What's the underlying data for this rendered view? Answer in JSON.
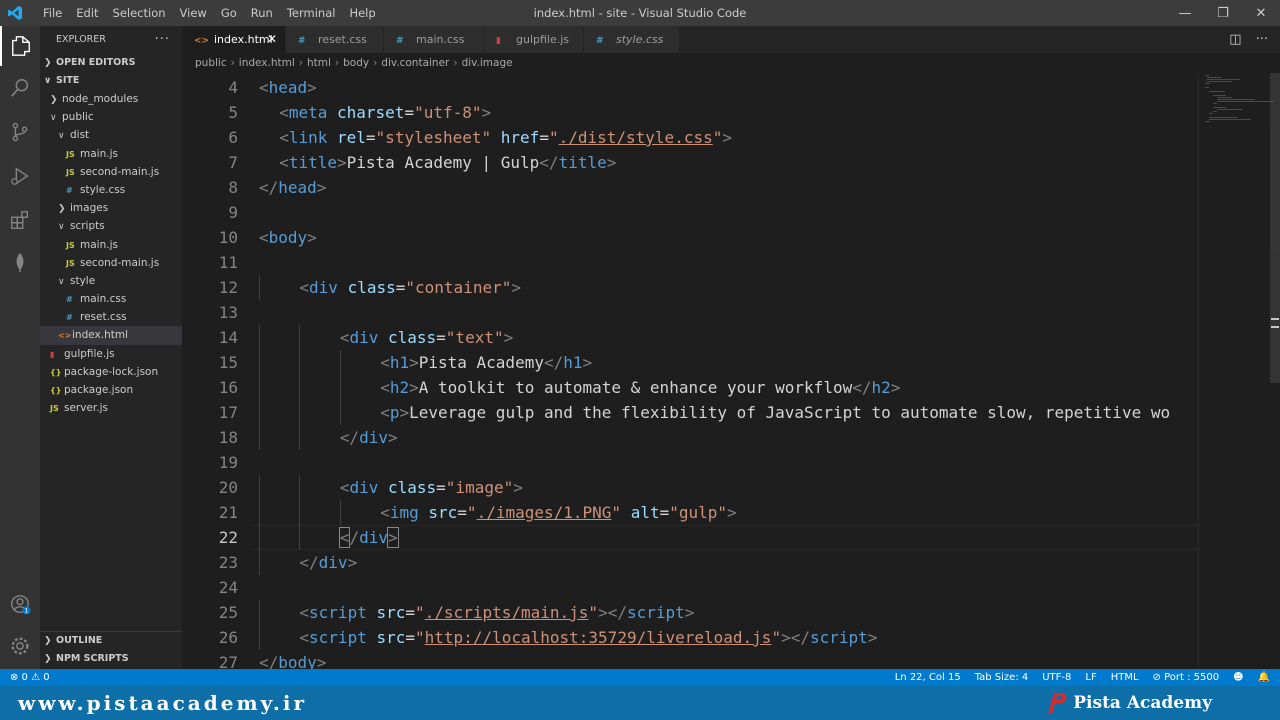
{
  "window": {
    "title": "index.html - site - Visual Studio Code",
    "menu": [
      "File",
      "Edit",
      "Selection",
      "View",
      "Go",
      "Run",
      "Terminal",
      "Help"
    ],
    "controls": [
      "minimize-icon",
      "maximize-icon",
      "close-icon"
    ]
  },
  "activity_bar": {
    "items": [
      "files-icon",
      "search-icon",
      "source-control-icon",
      "run-debug-icon",
      "extensions-icon",
      "mongodb-leaf-icon",
      "account-icon",
      "settings-gear-icon"
    ],
    "account_badge": "1"
  },
  "sidebar": {
    "title": "EXPLORER",
    "more": "···",
    "open_editors": "OPEN EDITORS",
    "workspace": "SITE",
    "tree": [
      {
        "label": "node_modules",
        "type": "folder",
        "expanded": false,
        "depth": 1
      },
      {
        "label": "public",
        "type": "folder",
        "expanded": true,
        "depth": 1
      },
      {
        "label": "dist",
        "type": "folder",
        "expanded": true,
        "depth": 2
      },
      {
        "label": "main.js",
        "type": "js",
        "depth": 3
      },
      {
        "label": "second-main.js",
        "type": "js",
        "depth": 3
      },
      {
        "label": "style.css",
        "type": "css",
        "depth": 3
      },
      {
        "label": "images",
        "type": "folder",
        "expanded": false,
        "depth": 2
      },
      {
        "label": "scripts",
        "type": "folder",
        "expanded": true,
        "depth": 2
      },
      {
        "label": "main.js",
        "type": "js",
        "depth": 3
      },
      {
        "label": "second-main.js",
        "type": "js",
        "depth": 3
      },
      {
        "label": "style",
        "type": "folder",
        "expanded": true,
        "depth": 2
      },
      {
        "label": "main.css",
        "type": "css",
        "depth": 3
      },
      {
        "label": "reset.css",
        "type": "css",
        "depth": 3
      },
      {
        "label": "index.html",
        "type": "html",
        "depth": 2,
        "selected": true
      },
      {
        "label": "gulpfile.js",
        "type": "gulp",
        "depth": 1
      },
      {
        "label": "package-lock.json",
        "type": "json",
        "depth": 1
      },
      {
        "label": "package.json",
        "type": "json",
        "depth": 1
      },
      {
        "label": "server.js",
        "type": "js",
        "depth": 1
      }
    ],
    "outline": "OUTLINE",
    "npm_scripts": "NPM SCRIPTS"
  },
  "tabs": [
    {
      "label": "index.html",
      "type": "html",
      "active": true,
      "italic": false
    },
    {
      "label": "reset.css",
      "type": "css",
      "active": false,
      "italic": false
    },
    {
      "label": "main.css",
      "type": "css",
      "active": false,
      "italic": false
    },
    {
      "label": "gulpfile.js",
      "type": "gulp",
      "active": false,
      "italic": false
    },
    {
      "label": "style.css",
      "type": "css",
      "active": false,
      "italic": true
    }
  ],
  "breadcrumb": [
    "public",
    "index.html",
    "html",
    "body",
    "div.container",
    "div.image"
  ],
  "editor": {
    "current_line": 22,
    "lines": [
      {
        "n": 4,
        "indent": 0,
        "tokens": [
          [
            "p",
            "<"
          ],
          [
            "t",
            "head"
          ],
          [
            "p",
            ">"
          ]
        ]
      },
      {
        "n": 5,
        "indent": 1,
        "tokens": [
          [
            "p",
            "<"
          ],
          [
            "t",
            "meta"
          ],
          [
            "d",
            " "
          ],
          [
            "a",
            "charset"
          ],
          [
            "d",
            "="
          ],
          [
            "s",
            "\"utf-8\""
          ],
          [
            "p",
            ">"
          ]
        ]
      },
      {
        "n": 6,
        "indent": 1,
        "tokens": [
          [
            "p",
            "<"
          ],
          [
            "t",
            "link"
          ],
          [
            "d",
            " "
          ],
          [
            "a",
            "rel"
          ],
          [
            "d",
            "="
          ],
          [
            "s",
            "\"stylesheet\""
          ],
          [
            "d",
            " "
          ],
          [
            "a",
            "href"
          ],
          [
            "d",
            "="
          ],
          [
            "s",
            "\""
          ],
          [
            "u",
            "./dist/style.css"
          ],
          [
            "s",
            "\""
          ],
          [
            "p",
            ">"
          ]
        ]
      },
      {
        "n": 7,
        "indent": 1,
        "tokens": [
          [
            "p",
            "<"
          ],
          [
            "t",
            "title"
          ],
          [
            "p",
            ">"
          ],
          [
            "d",
            "Pista Academy | Gulp"
          ],
          [
            "p",
            "</"
          ],
          [
            "t",
            "title"
          ],
          [
            "p",
            ">"
          ]
        ]
      },
      {
        "n": 8,
        "indent": 0,
        "tokens": [
          [
            "p",
            "</"
          ],
          [
            "t",
            "head"
          ],
          [
            "p",
            ">"
          ]
        ]
      },
      {
        "n": 9,
        "indent": 0,
        "tokens": []
      },
      {
        "n": 10,
        "indent": 0,
        "tokens": [
          [
            "p",
            "<"
          ],
          [
            "t",
            "body"
          ],
          [
            "p",
            ">"
          ]
        ]
      },
      {
        "n": 11,
        "indent": 0,
        "tokens": []
      },
      {
        "n": 12,
        "indent": 2,
        "tokens": [
          [
            "p",
            "<"
          ],
          [
            "t",
            "div"
          ],
          [
            "d",
            " "
          ],
          [
            "a",
            "class"
          ],
          [
            "d",
            "="
          ],
          [
            "s",
            "\"container\""
          ],
          [
            "p",
            ">"
          ]
        ]
      },
      {
        "n": 13,
        "indent": 0,
        "tokens": []
      },
      {
        "n": 14,
        "indent": 4,
        "tokens": [
          [
            "p",
            "<"
          ],
          [
            "t",
            "div"
          ],
          [
            "d",
            " "
          ],
          [
            "a",
            "class"
          ],
          [
            "d",
            "="
          ],
          [
            "s",
            "\"text\""
          ],
          [
            "p",
            ">"
          ]
        ]
      },
      {
        "n": 15,
        "indent": 6,
        "tokens": [
          [
            "p",
            "<"
          ],
          [
            "t",
            "h1"
          ],
          [
            "p",
            ">"
          ],
          [
            "d",
            "Pista Academy"
          ],
          [
            "p",
            "</"
          ],
          [
            "t",
            "h1"
          ],
          [
            "p",
            ">"
          ]
        ]
      },
      {
        "n": 16,
        "indent": 6,
        "tokens": [
          [
            "p",
            "<"
          ],
          [
            "t",
            "h2"
          ],
          [
            "p",
            ">"
          ],
          [
            "d",
            "A toolkit to automate & enhance your workflow"
          ],
          [
            "p",
            "</"
          ],
          [
            "t",
            "h2"
          ],
          [
            "p",
            ">"
          ]
        ]
      },
      {
        "n": 17,
        "indent": 6,
        "tokens": [
          [
            "p",
            "<"
          ],
          [
            "t",
            "p"
          ],
          [
            "p",
            ">"
          ],
          [
            "d",
            "Leverage gulp and the flexibility of JavaScript to automate slow, repetitive wo"
          ]
        ]
      },
      {
        "n": 18,
        "indent": 4,
        "tokens": [
          [
            "p",
            "</"
          ],
          [
            "t",
            "div"
          ],
          [
            "p",
            ">"
          ]
        ]
      },
      {
        "n": 19,
        "indent": 0,
        "tokens": []
      },
      {
        "n": 20,
        "indent": 4,
        "tokens": [
          [
            "p",
            "<"
          ],
          [
            "t",
            "div"
          ],
          [
            "d",
            " "
          ],
          [
            "a",
            "class"
          ],
          [
            "d",
            "="
          ],
          [
            "s",
            "\"image\""
          ],
          [
            "p",
            ">"
          ]
        ]
      },
      {
        "n": 21,
        "indent": 6,
        "tokens": [
          [
            "p",
            "<"
          ],
          [
            "t",
            "img"
          ],
          [
            "d",
            " "
          ],
          [
            "a",
            "src"
          ],
          [
            "d",
            "="
          ],
          [
            "s",
            "\""
          ],
          [
            "u",
            "./images/1.PNG"
          ],
          [
            "s",
            "\""
          ],
          [
            "d",
            " "
          ],
          [
            "a",
            "alt"
          ],
          [
            "d",
            "="
          ],
          [
            "s",
            "\"gulp\""
          ],
          [
            "p",
            ">"
          ]
        ]
      },
      {
        "n": 22,
        "indent": 4,
        "tokens": [
          [
            "pb",
            "<"
          ],
          [
            "p",
            "/"
          ],
          [
            "t",
            "div"
          ],
          [
            "pb",
            ">"
          ]
        ]
      },
      {
        "n": 23,
        "indent": 2,
        "tokens": [
          [
            "p",
            "</"
          ],
          [
            "t",
            "div"
          ],
          [
            "p",
            ">"
          ]
        ]
      },
      {
        "n": 24,
        "indent": 0,
        "tokens": []
      },
      {
        "n": 25,
        "indent": 2,
        "tokens": [
          [
            "p",
            "<"
          ],
          [
            "t",
            "script"
          ],
          [
            "d",
            " "
          ],
          [
            "a",
            "src"
          ],
          [
            "d",
            "="
          ],
          [
            "s",
            "\""
          ],
          [
            "u",
            "./scripts/main.js"
          ],
          [
            "s",
            "\""
          ],
          [
            "p",
            "></"
          ],
          [
            "t",
            "script"
          ],
          [
            "p",
            ">"
          ]
        ]
      },
      {
        "n": 26,
        "indent": 2,
        "tokens": [
          [
            "p",
            "<"
          ],
          [
            "t",
            "script"
          ],
          [
            "d",
            " "
          ],
          [
            "a",
            "src"
          ],
          [
            "d",
            "="
          ],
          [
            "s",
            "\""
          ],
          [
            "u",
            "http://localhost:35729/livereload.js"
          ],
          [
            "s",
            "\""
          ],
          [
            "p",
            "></"
          ],
          [
            "t",
            "script"
          ],
          [
            "p",
            ">"
          ]
        ]
      },
      {
        "n": 27,
        "indent": 0,
        "tokens": [
          [
            "p",
            "</"
          ],
          [
            "t",
            "body"
          ],
          [
            "p",
            ">"
          ]
        ]
      }
    ]
  },
  "statusbar": {
    "problems": "⊗ 0 ⚠ 0",
    "position": "Ln 22, Col 15",
    "tab_size": "Tab Size: 4",
    "encoding": "UTF-8",
    "eol": "LF",
    "language": "HTML",
    "port": "⊘ Port : 5500"
  },
  "footer": {
    "site": "www.pistaacademy.ir",
    "brand": "Pista Academy"
  },
  "colors": {
    "accent": "#007acc",
    "tag": "#569cd6",
    "attribute": "#9cdcfe",
    "string": "#ce9178",
    "punctuation": "#808080"
  }
}
